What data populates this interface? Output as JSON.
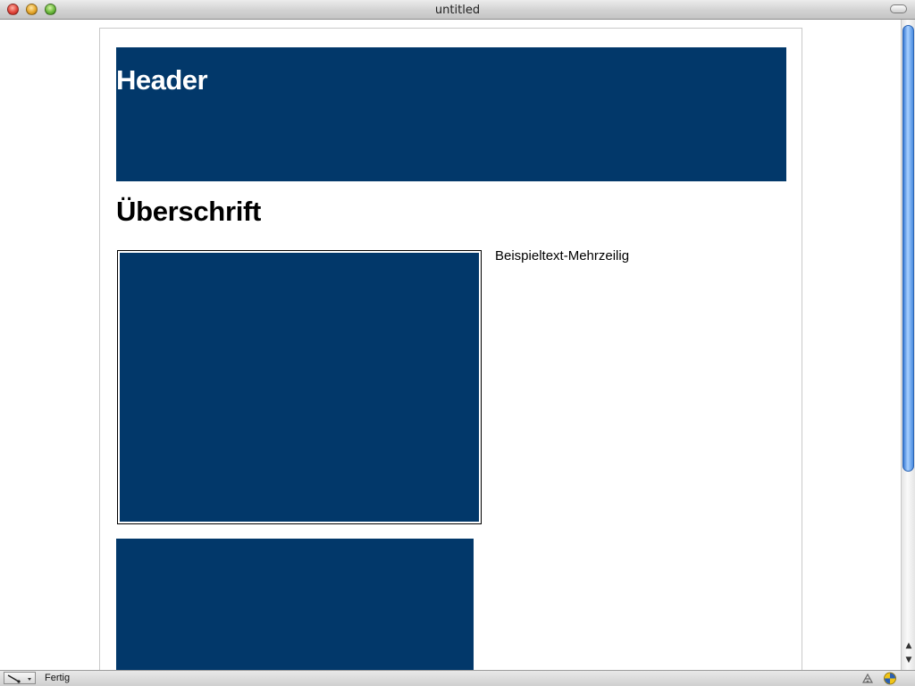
{
  "window": {
    "title": "untitled"
  },
  "page": {
    "header_title": "Header",
    "heading": "Überschrift",
    "body_text": "Beispieltext-Mehrzeilig",
    "accent_color": "#02386a"
  },
  "statusbar": {
    "status_text": "Fertig",
    "icons": [
      "pen-tool-icon",
      "connection-icon",
      "security-icon"
    ]
  },
  "scrollbar": {
    "up_arrow": "▲",
    "down_arrow": "▼"
  }
}
